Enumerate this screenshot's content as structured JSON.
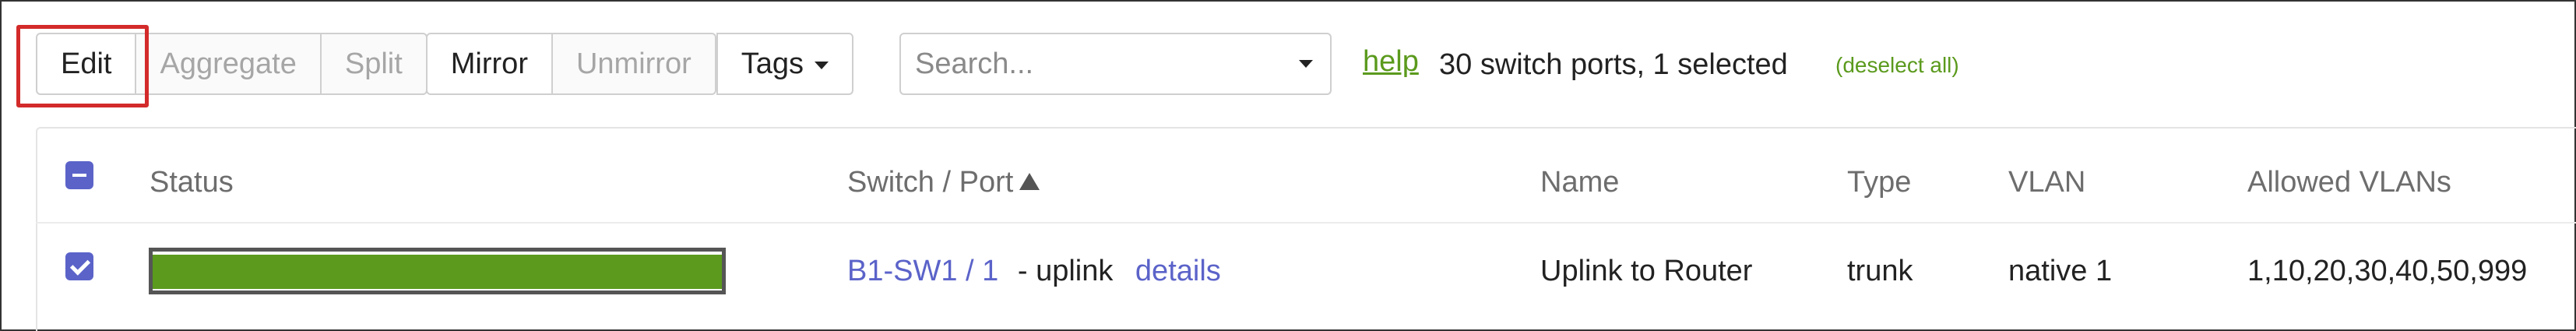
{
  "toolbar": {
    "edit_label": "Edit",
    "aggregate_label": "Aggregate",
    "split_label": "Split",
    "mirror_label": "Mirror",
    "unmirror_label": "Unmirror",
    "tags_label": "Tags",
    "search_placeholder": "Search...",
    "help_label": "help",
    "summary_text": "30 switch ports, 1 selected",
    "deselect_label": "(deselect all)"
  },
  "table": {
    "headers": {
      "status": "Status",
      "switch_port": "Switch / Port",
      "name": "Name",
      "type": "Type",
      "vlan": "VLAN",
      "allowed_vlans": "Allowed VLANs"
    },
    "rows": [
      {
        "selected": true,
        "status_level": 1.0,
        "switch_port": "B1-SW1 / 1",
        "port_suffix": "- uplink",
        "details_label": "details",
        "name": "Uplink to Router",
        "type": "trunk",
        "vlan": "native 1",
        "allowed_vlans": "1,10,20,30,40,50,999"
      }
    ]
  },
  "colors": {
    "accent": "#5b63c9",
    "status_green": "#5b9a1d",
    "highlight_red": "#d32a2a",
    "help_green": "#5b9a1d"
  }
}
